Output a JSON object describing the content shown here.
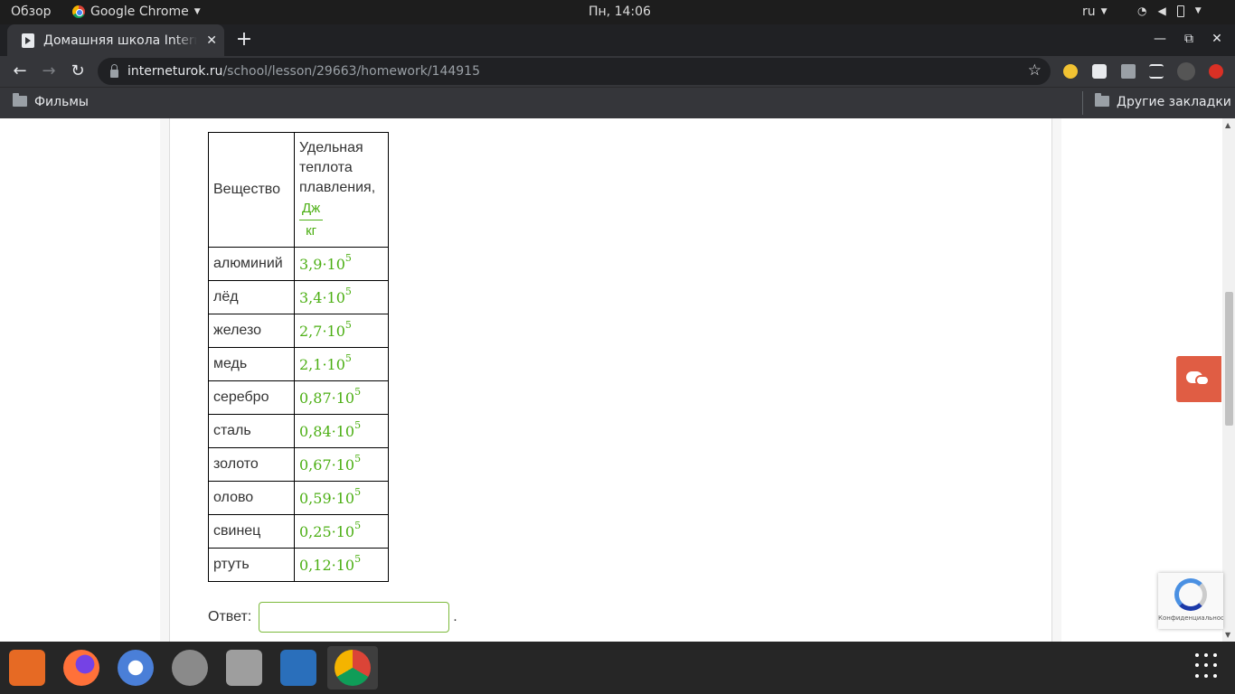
{
  "topbar": {
    "overview": "Обзор",
    "app": "Google Chrome",
    "clock": "Пн, 14:06",
    "lang": "ru"
  },
  "tab": {
    "title": "Домашняя школа Interne",
    "close": "✕"
  },
  "window": {
    "minimize": "—",
    "maximize": "⧉",
    "close": "✕"
  },
  "toolbar": {
    "url_host": "interneturok.ru",
    "url_path": "/school/lesson/29663/homework/144915"
  },
  "bookmarks": {
    "left": "Фильмы",
    "right": "Другие закладки"
  },
  "table": {
    "header_substance": "Вещество",
    "header_heat": "Удельная теплота плавления,",
    "unit_num": "Дж",
    "unit_den": "кг",
    "rows": [
      {
        "name": "алюминий",
        "mantissa": "3,9·10",
        "exp": "5"
      },
      {
        "name": "лёд",
        "mantissa": "3,4·10",
        "exp": "5"
      },
      {
        "name": "железо",
        "mantissa": "2,7·10",
        "exp": "5"
      },
      {
        "name": "медь",
        "mantissa": "2,1·10",
        "exp": "5"
      },
      {
        "name": "серебро",
        "mantissa": "0,87·10",
        "exp": "5"
      },
      {
        "name": "сталь",
        "mantissa": "0,84·10",
        "exp": "5"
      },
      {
        "name": "золото",
        "mantissa": "0,67·10",
        "exp": "5"
      },
      {
        "name": "олово",
        "mantissa": "0,59·10",
        "exp": "5"
      },
      {
        "name": "свинец",
        "mantissa": "0,25·10",
        "exp": "5"
      },
      {
        "name": "ртуть",
        "mantissa": "0,12·10",
        "exp": "5"
      }
    ]
  },
  "answer": {
    "label": "Ответ:",
    "value": "",
    "suffix": "."
  },
  "recaptcha": {
    "text": "Конфиденциальность - Условия"
  },
  "colors": {
    "accent_green": "#4caf14",
    "chat_button": "#e05d44"
  },
  "dock": {
    "apps": [
      "app-center-icon",
      "firefox-icon",
      "chromium-icon",
      "settings-icon",
      "files-icon",
      "writer-icon",
      "chrome-icon"
    ]
  }
}
